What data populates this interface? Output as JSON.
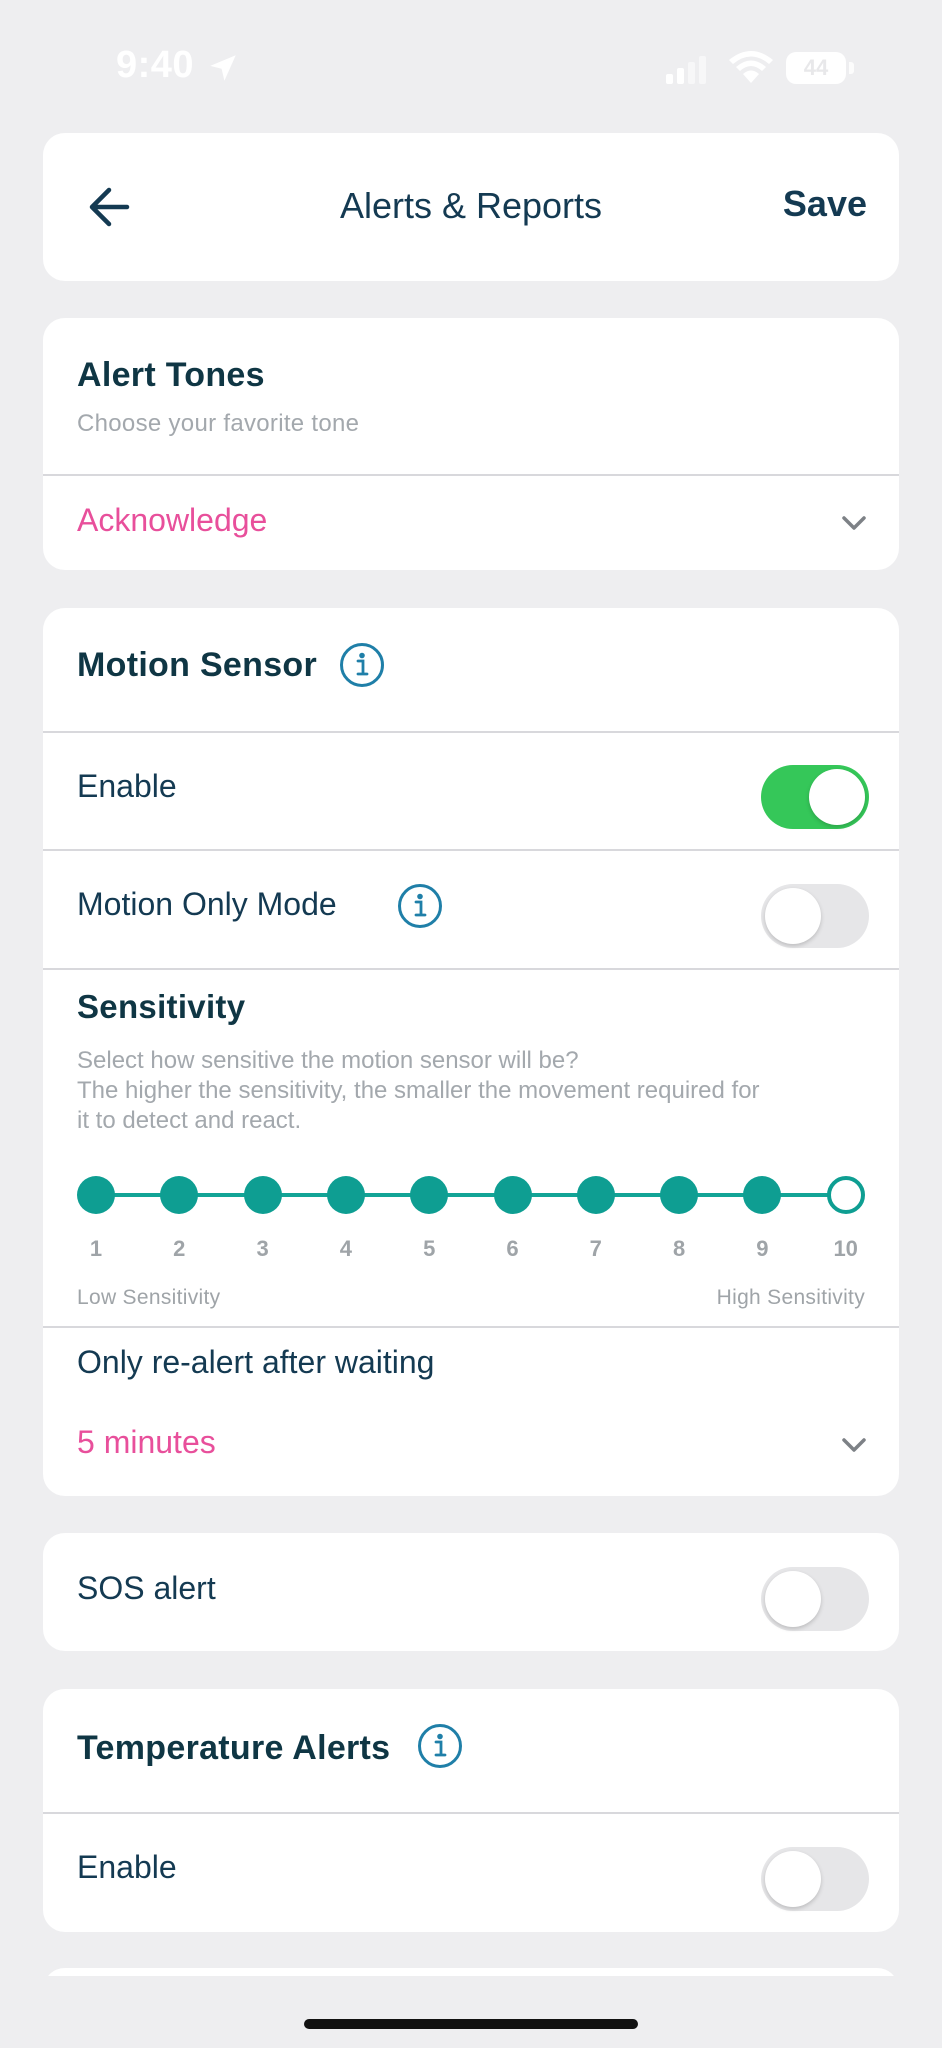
{
  "status_bar": {
    "time": "9:40",
    "battery": "44"
  },
  "header": {
    "title": "Alerts & Reports",
    "save_label": "Save"
  },
  "alert_tones": {
    "title": "Alert Tones",
    "subtitle": "Choose your favorite tone",
    "selected": "Acknowledge"
  },
  "motion_sensor": {
    "title": "Motion Sensor",
    "enable_label": "Enable",
    "enable_on": true,
    "motion_only_label": "Motion Only Mode",
    "motion_only_on": false,
    "sensitivity": {
      "title": "Sensitivity",
      "description_line1": "Select how sensitive the motion sensor will be?",
      "description_line2": "The higher the sensitivity, the smaller the movement required for",
      "description_line3": "it to detect and react.",
      "levels": [
        "1",
        "2",
        "3",
        "4",
        "5",
        "6",
        "7",
        "8",
        "9",
        "10"
      ],
      "selected_level": 10,
      "low_label": "Low Sensitivity",
      "high_label": "High Sensitivity"
    },
    "realert_label": "Only re-alert after waiting",
    "realert_value": "5 minutes"
  },
  "sos": {
    "label": "SOS alert",
    "on": false
  },
  "temperature": {
    "title": "Temperature Alerts",
    "enable_label": "Enable",
    "enable_on": false
  },
  "colors": {
    "accent_pink": "#e84f9b",
    "teal": "#0e9e92",
    "toggle_on": "#35c759",
    "text_dark": "#143a52"
  },
  "icons": {
    "back": "arrow-left-icon",
    "info": "info-icon",
    "chevron": "chevron-down-icon"
  }
}
